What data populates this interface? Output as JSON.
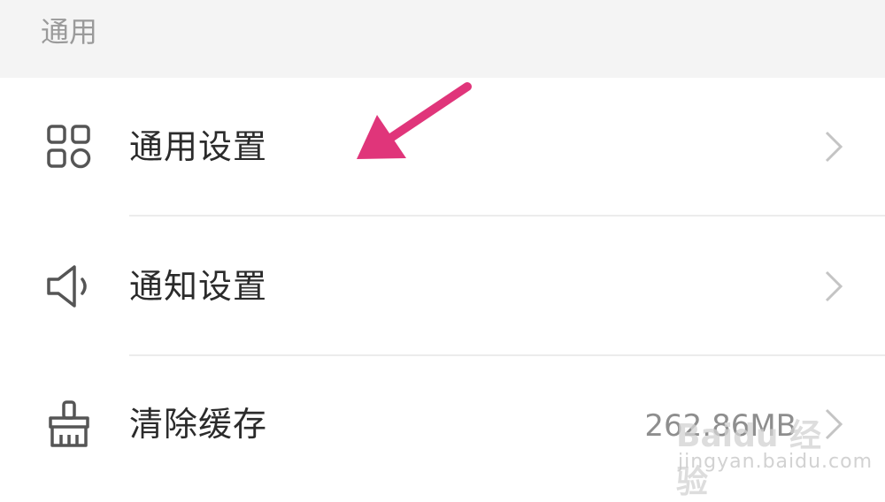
{
  "section": {
    "title": "通用"
  },
  "rows": [
    {
      "label": "通用设置",
      "icon": "grid-apps-icon",
      "value": ""
    },
    {
      "label": "通知设置",
      "icon": "speaker-icon",
      "value": ""
    },
    {
      "label": "清除缓存",
      "icon": "brush-icon",
      "value": "262.86MB"
    }
  ],
  "watermark": {
    "logo": "Baidu 经验",
    "url": "jingyan.baidu.com"
  },
  "colors": {
    "arrow": "#e0357a",
    "icon": "#555555",
    "chevron": "#c4c4c4",
    "header_bg": "#f4f4f4"
  }
}
